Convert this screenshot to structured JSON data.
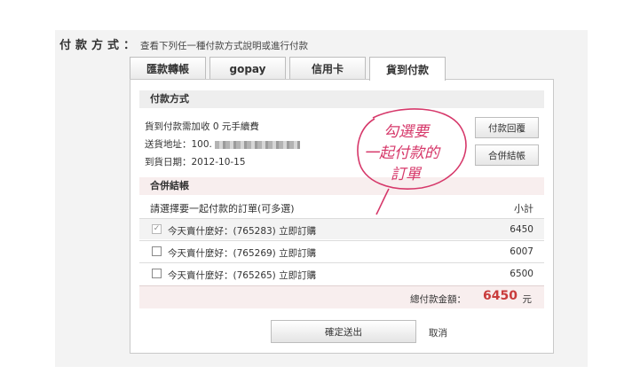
{
  "header": {
    "title": "付款方式",
    "colon": "：",
    "description": "查看下列任一種付款方式說明或進行付款"
  },
  "tabs": [
    {
      "label": "匯款轉帳",
      "active": false
    },
    {
      "label": "gopay",
      "active": false
    },
    {
      "label": "信用卡",
      "active": false
    },
    {
      "label": "貨到付款",
      "active": true
    }
  ],
  "payment_section": {
    "title": "付款方式",
    "fee_line": "貨到付款需加收 0 元手續費",
    "address_label": "送貨地址：100.",
    "date_line": "到貨日期：2012-10-15",
    "reply_button": "付款回覆",
    "merge_button": "合併結帳"
  },
  "merge_section": {
    "title": "合併結帳",
    "column_select": "請選擇要一起付款的訂單(可多選)",
    "column_subtotal": "小計",
    "orders": [
      {
        "name": "今天賣什麼好：(765283) 立即訂購",
        "amount": "6450",
        "checked": true,
        "disabled": true
      },
      {
        "name": "今天賣什麼好：(765269) 立即訂購",
        "amount": "6007",
        "checked": false,
        "disabled": false
      },
      {
        "name": "今天賣什麼好：(765265) 立即訂購",
        "amount": "6500",
        "checked": false,
        "disabled": false
      }
    ],
    "total_label": "總付款金額：",
    "total_value": "6450",
    "total_unit": "元"
  },
  "actions": {
    "confirm": "確定送出",
    "cancel": "取消"
  },
  "annotation": {
    "line1": "勾選要",
    "line2": "一起付款的",
    "line3": "訂單",
    "color": "#d6386a"
  }
}
